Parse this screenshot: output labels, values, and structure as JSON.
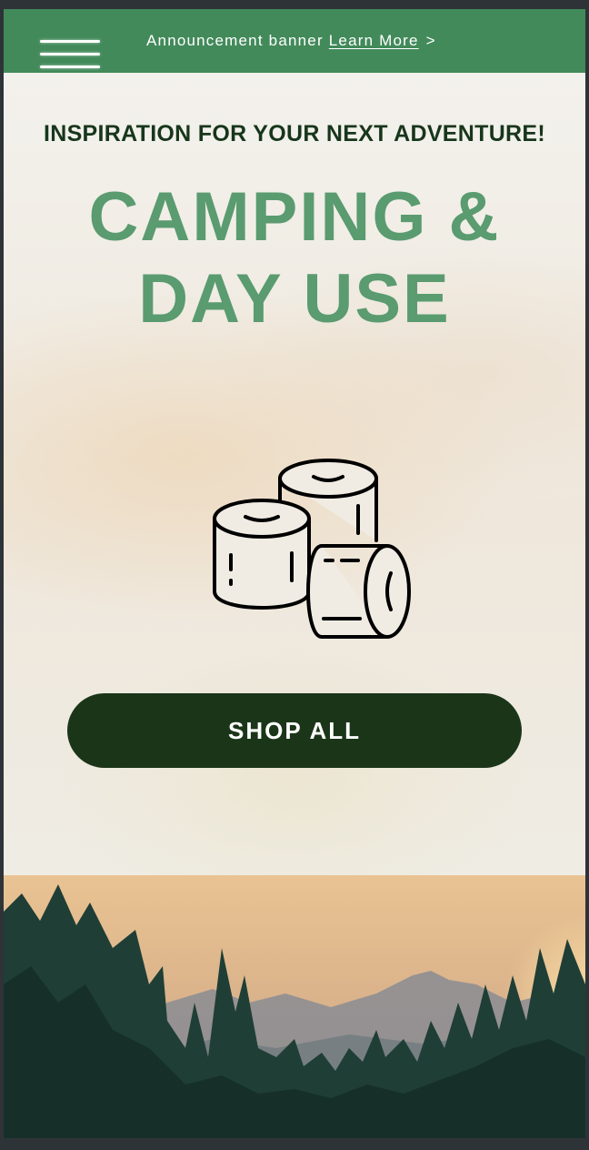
{
  "announcement": {
    "text": "Announcement banner",
    "link_label": "Learn More",
    "chevron": ">"
  },
  "hero": {
    "tagline": "INSPIRATION FOR YOUR NEXT ADVENTURE!",
    "headline_line1": "CAMPING &",
    "headline_line2": "DAY USE",
    "icon": "toilet-paper-rolls-icon",
    "cta_label": "SHOP ALL"
  },
  "icons": {
    "menu": "hamburger-menu-icon",
    "product": "toilet-paper-rolls-icon"
  },
  "colors": {
    "announcement_bg": "#428a5a",
    "tagline": "#17361c",
    "headline": "#5a9b70",
    "cta_bg": "#1b3519",
    "cta_text": "#ffffff"
  }
}
